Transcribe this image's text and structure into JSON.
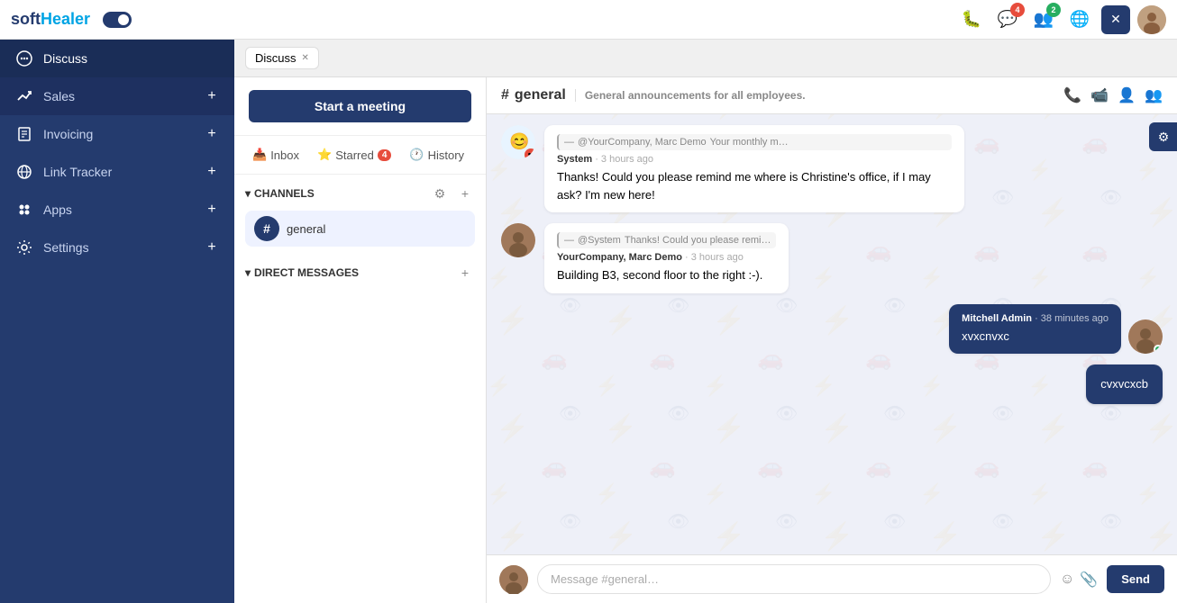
{
  "topbar": {
    "logo_text_soft": "soft",
    "logo_text_healer": "Healer",
    "icons": [
      {
        "name": "bug-icon",
        "symbol": "🐛",
        "badge": null
      },
      {
        "name": "chat-icon",
        "symbol": "💬",
        "badge": "4"
      },
      {
        "name": "users-icon",
        "symbol": "👥",
        "badge": "2",
        "badge_color": "green"
      },
      {
        "name": "globe-icon",
        "symbol": "🌐",
        "badge": null
      },
      {
        "name": "close-icon",
        "symbol": "✕",
        "active": true
      }
    ]
  },
  "sidebar": {
    "items": [
      {
        "id": "discuss",
        "label": "Discuss",
        "icon": "💬",
        "active": true
      },
      {
        "id": "sales",
        "label": "Sales",
        "icon": "📈",
        "has_add": true
      },
      {
        "id": "invoicing",
        "label": "Invoicing",
        "icon": "≡",
        "has_add": true
      },
      {
        "id": "link-tracker",
        "label": "Link Tracker",
        "icon": "🔗",
        "has_add": true
      },
      {
        "id": "apps",
        "label": "Apps",
        "icon": "⚙",
        "has_add": true
      },
      {
        "id": "settings",
        "label": "Settings",
        "icon": "⚙",
        "has_add": true
      }
    ]
  },
  "tabs": [
    {
      "label": "Discuss",
      "closable": true
    }
  ],
  "left_panel": {
    "start_meeting_btn": "Start a meeting",
    "msg_tabs": [
      {
        "label": "Inbox",
        "icon": "📥",
        "badge": null
      },
      {
        "label": "Starred",
        "icon": "⭐",
        "badge": "4"
      },
      {
        "label": "History",
        "icon": "🕐",
        "badge": null
      }
    ],
    "channels_label": "CHANNELS",
    "channels": [
      {
        "name": "general",
        "icon": "#"
      }
    ],
    "direct_messages_label": "DIRECT MESSAGES"
  },
  "chat": {
    "channel_symbol": "#",
    "channel_name": "general",
    "channel_desc": "General announcements for all employees.",
    "messages": [
      {
        "id": "msg1",
        "type": "received",
        "avatar_type": "bot",
        "reply_from": "@YourCompany, Marc Demo",
        "reply_text": "Your monthly m…",
        "sender": "System",
        "time": "3 hours ago",
        "text": "Thanks! Could you please remind me where is Christine's office, if I may ask? I'm new here!"
      },
      {
        "id": "msg2",
        "type": "received",
        "avatar_type": "user",
        "reply_from": "@System",
        "reply_text": "Thanks! Could you please remi…",
        "sender": "YourCompany, Marc Demo",
        "time": "3 hours ago",
        "text": "Building B3, second floor to the right :-)."
      },
      {
        "id": "msg3",
        "type": "sent",
        "sender": "Mitchell Admin",
        "time": "38 minutes ago",
        "text": "xvxcnvxc"
      },
      {
        "id": "msg4",
        "type": "sent_only",
        "text": "cvxvcxcb"
      }
    ],
    "input_placeholder": "Message #general…",
    "send_btn": "Send"
  }
}
